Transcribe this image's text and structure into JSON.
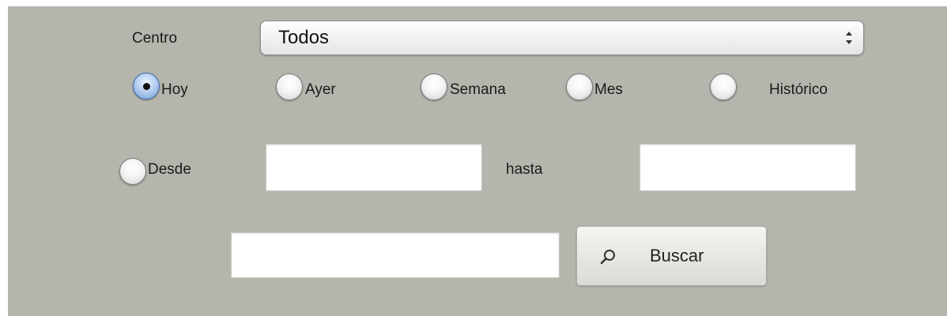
{
  "filters": {
    "centro_label": "Centro",
    "centro_select": {
      "value": "Todos"
    },
    "period": {
      "selected": "Hoy",
      "options": [
        "Hoy",
        "Ayer",
        "Semana",
        "Mes",
        "Histórico"
      ]
    },
    "range": {
      "desde_label": "Desde",
      "desde_value": "",
      "hasta_label": "hasta",
      "hasta_value": ""
    }
  },
  "search": {
    "query_value": "",
    "button_label": "Buscar"
  },
  "colors": {
    "panel_background": "#b6b5ad",
    "radio_selected": "#6f9bd6"
  },
  "icons": [
    "chevron-up-down-icon",
    "search-icon"
  ]
}
